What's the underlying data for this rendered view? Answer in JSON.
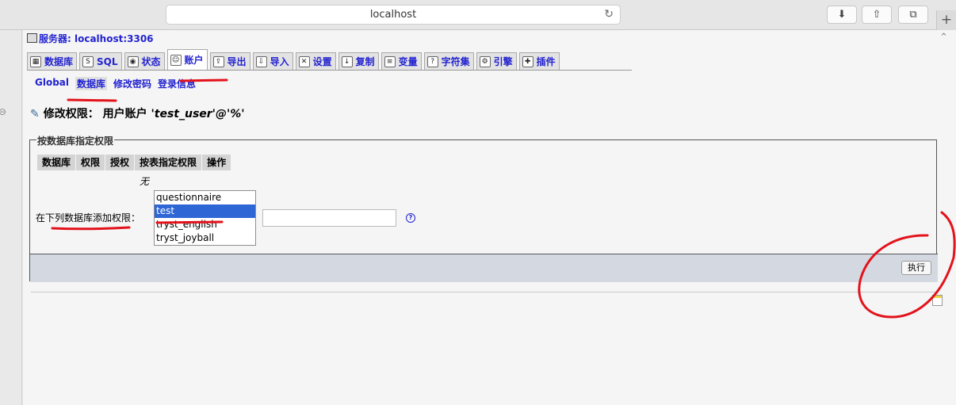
{
  "browser": {
    "url": "localhost"
  },
  "server": {
    "label": "服务器: localhost:3306"
  },
  "tabs": [
    {
      "label": "数据库",
      "icon": "database-icon"
    },
    {
      "label": "SQL",
      "icon": "sql-icon"
    },
    {
      "label": "状态",
      "icon": "status-icon"
    },
    {
      "label": "账户",
      "icon": "accounts-icon",
      "active": true
    },
    {
      "label": "导出",
      "icon": "export-icon"
    },
    {
      "label": "导入",
      "icon": "import-icon"
    },
    {
      "label": "设置",
      "icon": "settings-icon"
    },
    {
      "label": "复制",
      "icon": "replication-icon"
    },
    {
      "label": "变量",
      "icon": "variables-icon"
    },
    {
      "label": "字符集",
      "icon": "charset-icon"
    },
    {
      "label": "引擎",
      "icon": "engine-icon"
    },
    {
      "label": "插件",
      "icon": "plugin-icon"
    }
  ],
  "subtabs": [
    "Global",
    "数据库",
    "修改密码",
    "登录信息"
  ],
  "heading": {
    "prefix": "修改权限：",
    "user_label": "用户账户",
    "account": "'test_user'@'%'"
  },
  "fieldset": {
    "legend": "按数据库指定权限",
    "columns": [
      "数据库",
      "权限",
      "授权",
      "按表指定权限",
      "操作"
    ],
    "empty": "无",
    "add_label": "在下列数据库添加权限：",
    "databases": [
      "questionnaire",
      "test",
      "tryst_english",
      "tryst_joyball"
    ],
    "selected": "test",
    "go_label": "执行"
  }
}
